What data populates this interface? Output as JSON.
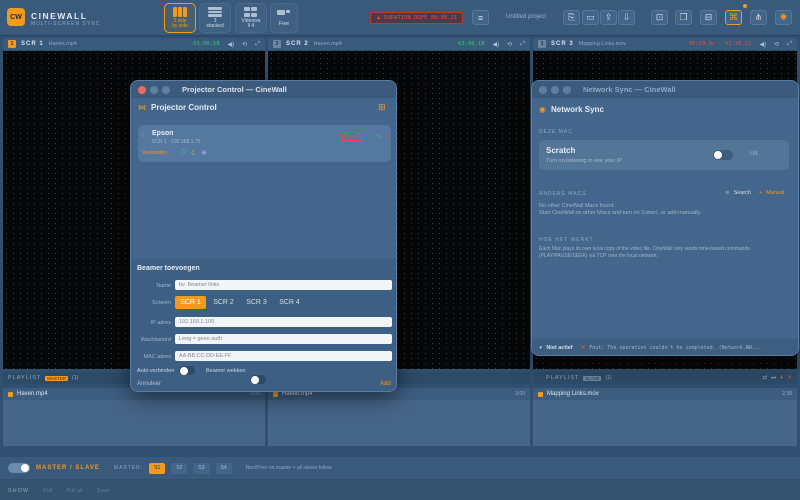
{
  "app": {
    "logo_text": "CW",
    "name": "CINEWALL",
    "subtitle": "MULTI-SCREEN SYNC"
  },
  "toolbar": {
    "layouts": [
      {
        "label": "3 side\nby side",
        "selected": true
      },
      {
        "label": "3\nstacked",
        "selected": false
      },
      {
        "label": "Videowa\nll 4",
        "selected": false
      },
      {
        "label": "Free",
        "selected": false
      }
    ],
    "duration_warning": "DURATION DIFF 00:08.21",
    "project_title": "Untitled project"
  },
  "screens": [
    {
      "num": "1",
      "name": "SCR 1",
      "file": "Haven.mp4",
      "time": "03:00.18",
      "time_color": "#2ecc71"
    },
    {
      "num": "2",
      "name": "SCR 2",
      "file": "Haven.mp4",
      "time": "03:00.18",
      "time_color": "#2ecc71"
    },
    {
      "num": "3",
      "name": "SCR 3",
      "file": "Mapping Links.mov",
      "time": "00:29.9s · 02:38.21",
      "time_color": "#e74c3c"
    }
  ],
  "playlists": [
    {
      "title": "PLAYLIST",
      "badge": "MASTER",
      "count": "(1)",
      "item": "Haven.mp4",
      "duration": "3:00"
    },
    {
      "title": "PLAYLIST",
      "badge": "",
      "count": "(1)",
      "item": "Haven.mp4",
      "duration": "3:00"
    },
    {
      "title": "PLAYLIST",
      "badge": "SLAVE",
      "count": "(1)",
      "item": "Mapping Links.mov",
      "duration": "2:38"
    }
  ],
  "bottom": {
    "master_slave": "MASTER / SLAVE",
    "master_label": "MASTER:",
    "segments": [
      "S1",
      "S2",
      "S3",
      "S4"
    ],
    "hint": "Next/Prev on master + all slaves follow"
  },
  "status": {
    "show": "SHOW",
    "items": [
      "Pull",
      "Pull all",
      "Save"
    ]
  },
  "projector": {
    "window_title": "Projector Control — CineWall",
    "header": "Projector Control",
    "device": {
      "name": "Epson",
      "info": "SCR 1 · 192.168.1.75",
      "state": "Offline",
      "connect": "Verbinden"
    },
    "add_title": "Beamer toevoegen",
    "name_label": "Name",
    "name_placeholder": "bv. Beamer links",
    "screen_label": "Scherm",
    "screens": [
      "SCR 1",
      "SCR 2",
      "SCR 3",
      "SCR 4"
    ],
    "ip_label": "IP adres",
    "ip_placeholder": "192.168.1.100",
    "password_label": "Wachtwoord",
    "password_placeholder": "Leeg = geen auth",
    "mac_label": "MAC adres",
    "mac_placeholder": "AA:BB:CC:DD:EE:FF",
    "auto_connect": "Auto-verbinden",
    "wake": "Beamer wekken",
    "cancel": "Annuleer",
    "add": "Add"
  },
  "network": {
    "window_title": "Network Sync — CineWall",
    "header": "Network Sync",
    "this_mac_label": "DEZE MAC",
    "device_name": "Scratch",
    "device_desc": "Turn on listening to see your IP",
    "toggle_label": "Uit",
    "other_macs_label": "ANDERE MACS",
    "search": "Search",
    "manual": "Manual",
    "empty_text": "No other CineWall Macs found.\nStart CineWall on other Macs and turn on 'Listen', or add manually.",
    "how_label": "HOE HET WERKT",
    "how_text": "Each Mac plays its own local copy of the video file. CineWall only sends time-based commands (PLAY/PAUSE/SEEK) via TCP over the local network.",
    "status_inactive": "Niet actief",
    "error_text": "Fout: The operation couldn't be completed. (Network.NW..."
  }
}
